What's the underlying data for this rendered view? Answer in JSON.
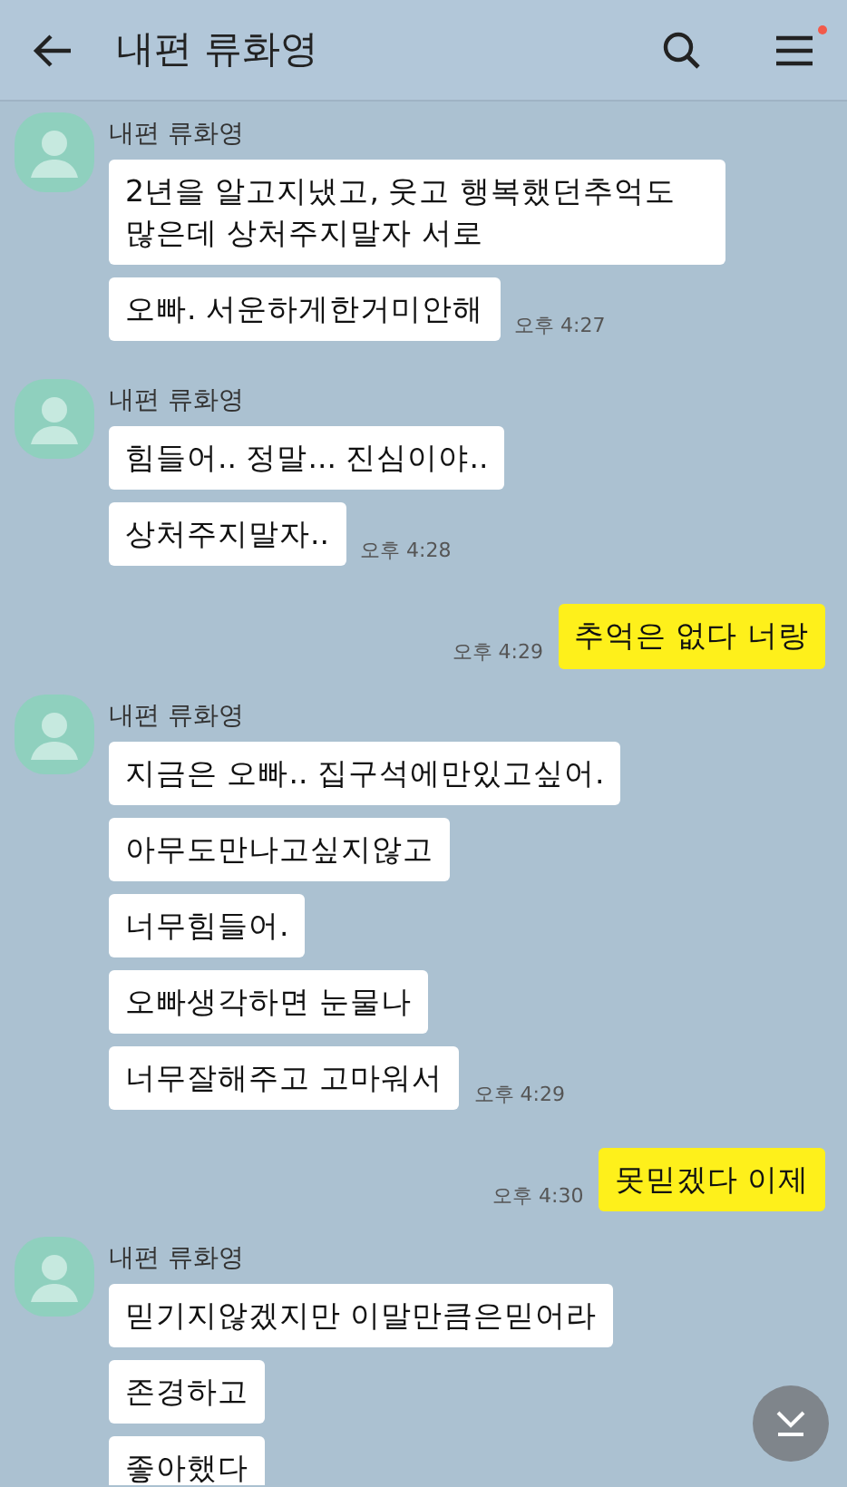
{
  "header": {
    "title": "내편 류화영",
    "menu_badge": true
  },
  "chat": [
    {
      "kind": "incoming",
      "sender": "내편 류화영",
      "messages": [
        {
          "text": "2년을 알고지냈고, 웃고 행복했던추억도 많은데  상처주지말자 서로"
        },
        {
          "text": "오빠. 서운하게한거미안해",
          "time": "오후 4:27"
        }
      ]
    },
    {
      "kind": "incoming",
      "sender": "내편 류화영",
      "messages": [
        {
          "text": "힘들어.. 정말... 진심이야.."
        },
        {
          "text": "상처주지말자..",
          "time": "오후 4:28"
        }
      ]
    },
    {
      "kind": "outgoing",
      "messages": [
        {
          "text": "추억은 없다 너랑",
          "time": "오후 4:29"
        }
      ]
    },
    {
      "kind": "incoming",
      "sender": "내편 류화영",
      "messages": [
        {
          "text": "지금은 오빠.. 집구석에만있고싶어."
        },
        {
          "text": "아무도만나고싶지않고"
        },
        {
          "text": "너무힘들어."
        },
        {
          "text": "오빠생각하면 눈물나"
        },
        {
          "text": "너무잘해주고 고마워서",
          "time": "오후 4:29"
        }
      ]
    },
    {
      "kind": "outgoing",
      "messages": [
        {
          "text": "못믿겠다 이제",
          "time": "오후 4:30"
        }
      ]
    },
    {
      "kind": "incoming",
      "sender": "내편 류화영",
      "messages": [
        {
          "text": "믿기지않겠지만 이말만큼은믿어라"
        },
        {
          "text": "존경하고"
        },
        {
          "text": "좋아했다"
        }
      ]
    }
  ]
}
